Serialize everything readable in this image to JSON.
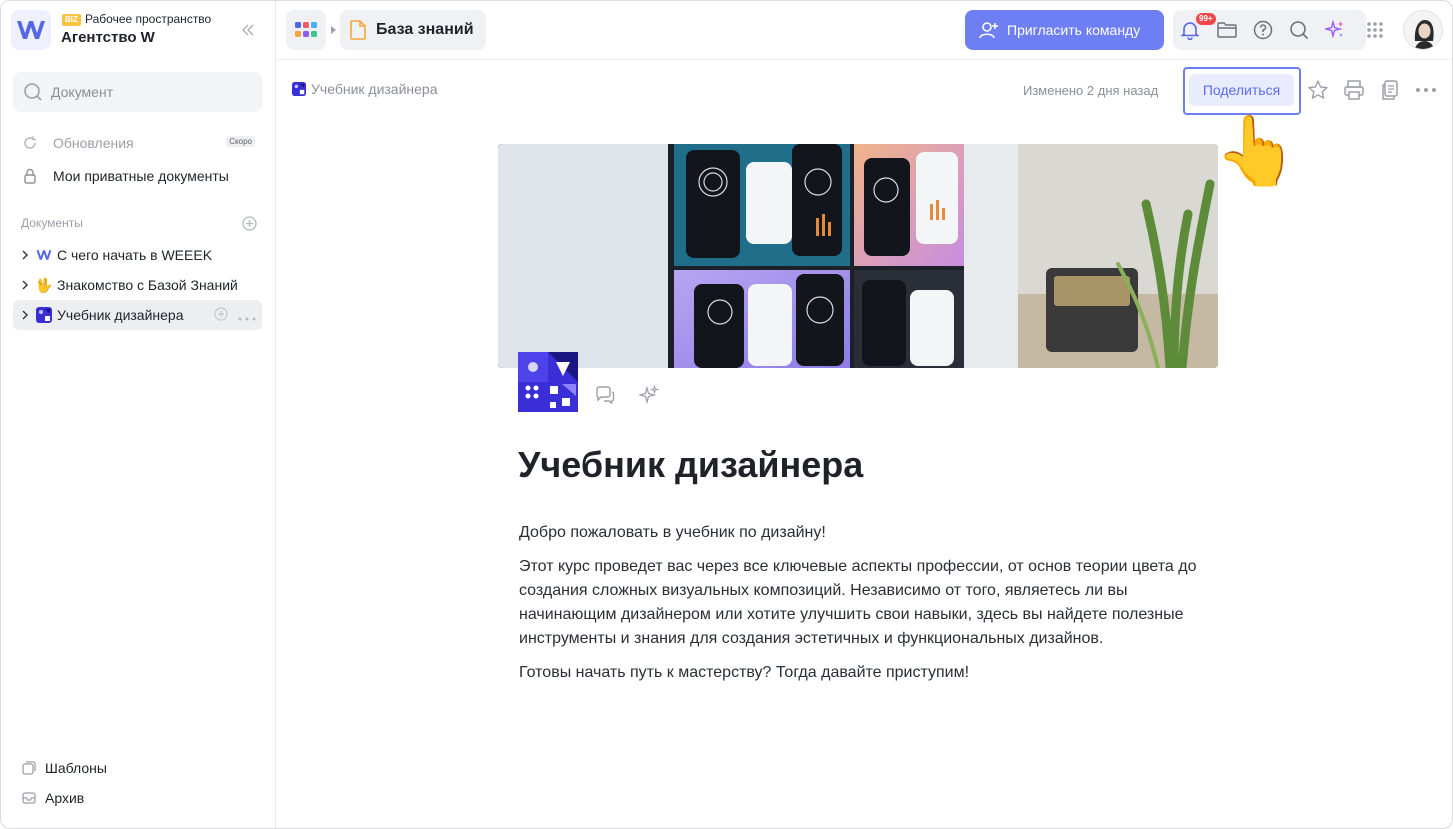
{
  "sidebar": {
    "workspace_badge": "BIZ",
    "workspace_label": "Рабочее пространство",
    "workspace_name": "Агентство W",
    "search_placeholder": "Документ",
    "updates_label": "Обновления",
    "updates_badge": "Скоро",
    "private_label": "Мои приватные документы",
    "documents_header": "Документы",
    "tree": [
      {
        "label": "С чего начать в WEEEK",
        "icon": "weeek-logo-icon"
      },
      {
        "label": "Знакомство с Базой Знаний",
        "icon": "hand-icon"
      },
      {
        "label": "Учебник дизайнера",
        "icon": "design-cover-icon",
        "active": true
      }
    ],
    "templates_label": "Шаблоны",
    "archive_label": "Архив"
  },
  "topbar": {
    "section_title": "База знаний",
    "invite_label": "Пригласить команду",
    "notifications_badge": "99+"
  },
  "document": {
    "breadcrumb": "Учебник дизайнера",
    "modified": "Изменено 2 дня назад",
    "share_label": "Поделиться",
    "title": "Учебник дизайнера",
    "paragraphs": [
      "Добро пожаловать в учебник по дизайну!",
      "Этот курс проведет вас через все ключевые аспекты профессии, от основ теории цвета до создания сложных визуальных композиций. Независимо от того, являетесь ли вы начинающим дизайнером или хотите улучшить свои навыки, здесь вы найдете полезные инструменты и знания для создания эстетичных и функциональных дизайнов.",
      "Готовы начать путь к мастерству? Тогда давайте приступим!"
    ]
  },
  "overlay": {
    "pointer_emoji": "👆"
  },
  "colors": {
    "accent": "#6e7ff3",
    "share_bg": "#e9ecff",
    "notif": "#f04848",
    "biz_badge": "#f6c343"
  }
}
